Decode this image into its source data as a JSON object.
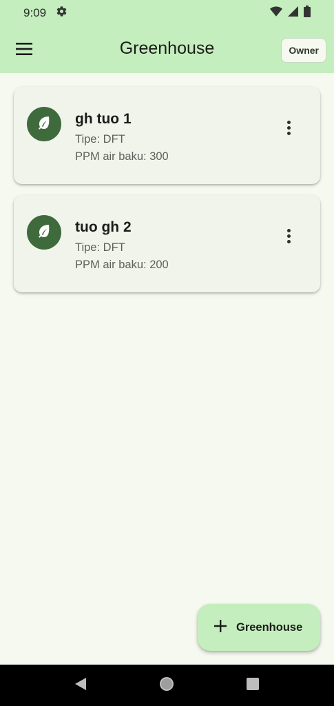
{
  "status_bar": {
    "time": "9:09",
    "icons": [
      "settings-icon",
      "wifi-icon",
      "signal-icon",
      "battery-icon"
    ]
  },
  "app_bar": {
    "title": "Greenhouse",
    "menu_icon": "menu-icon",
    "owner_label": "Owner"
  },
  "greenhouses": [
    {
      "name": "gh tuo 1",
      "type": "Tipe: DFT",
      "ppm": "PPM air baku: 300",
      "icon": "leaf-icon"
    },
    {
      "name": "tuo gh 2",
      "type": "Tipe: DFT",
      "ppm": "PPM air baku: 200",
      "icon": "leaf-icon"
    }
  ],
  "fab": {
    "label": "Greenhouse",
    "icon": "plus-icon"
  },
  "nav_bar": {
    "icons": [
      "back-icon",
      "home-icon",
      "recents-icon"
    ]
  },
  "colors": {
    "header_bg": "#c4eebd",
    "page_bg": "#f6f9f0",
    "card_bg": "#f1f4eb",
    "avatar_bg": "#3e6a3c"
  }
}
